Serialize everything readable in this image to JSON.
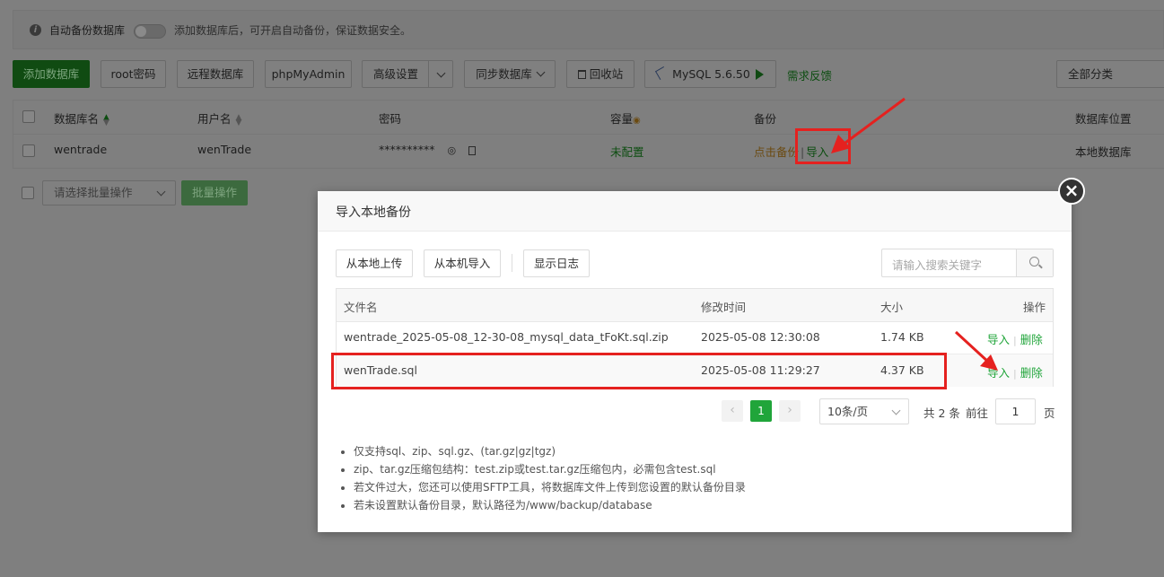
{
  "tipbar": {
    "label": "自动备份数据库",
    "desc": "添加数据库后，可开启自动备份，保证数据安全。"
  },
  "toolbar": {
    "add_db": "添加数据库",
    "root_pwd": "root密码",
    "remote_db": "远程数据库",
    "phpmyadmin": "phpMyAdmin",
    "advanced": "高级设置",
    "sync_db": "同步数据库",
    "recycle": "回收站",
    "mysql_version": "MySQL 5.6.50",
    "feedback": "需求反馈",
    "category": "全部分类"
  },
  "db_table": {
    "headers": {
      "name": "数据库名",
      "user": "用户名",
      "password": "密码",
      "capacity": "容量",
      "backup": "备份",
      "location": "数据库位置"
    },
    "row": {
      "name": "wentrade",
      "user": "wenTrade",
      "password": "**********",
      "capacity": "未配置",
      "backup_click": "点击备份",
      "backup_sep": "|",
      "import": "导入",
      "location": "本地数据库"
    }
  },
  "batch": {
    "placeholder": "请选择批量操作",
    "button": "批量操作"
  },
  "modal": {
    "title": "导入本地备份",
    "btn_upload_local": "从本地上传",
    "btn_import_machine": "从本机导入",
    "btn_show_log": "显示日志",
    "search_placeholder": "请输入搜索关键字",
    "headers": {
      "filename": "文件名",
      "mtime": "修改时间",
      "size": "大小",
      "ops": "操作"
    },
    "files": [
      {
        "name": "wentrade_2025-05-08_12-30-08_mysql_data_tFoKt.sql.zip",
        "mtime": "2025-05-08 12:30:08",
        "size": "1.74 KB",
        "import": "导入",
        "delete": "删除"
      },
      {
        "name": "wenTrade.sql",
        "mtime": "2025-05-08 11:29:27",
        "size": "4.37 KB",
        "import": "导入",
        "delete": "删除"
      }
    ],
    "pager": {
      "prev": "‹",
      "current": "1",
      "next": "›",
      "page_size": "10条/页",
      "total": "共 2 条",
      "goto": "前往",
      "goto_value": "1",
      "page_unit": "页"
    },
    "notes": [
      "仅支持sql、zip、sql.gz、(tar.gz|gz|tgz)",
      "zip、tar.gz压缩包结构：test.zip或test.tar.gz压缩包内，必需包含test.sql",
      "若文件过大，您还可以使用SFTP工具，将数据库文件上传到您设置的默认备份目录",
      "若未设置默认备份目录，默认路径为/www/backup/database"
    ],
    "close_glyph": "×"
  }
}
